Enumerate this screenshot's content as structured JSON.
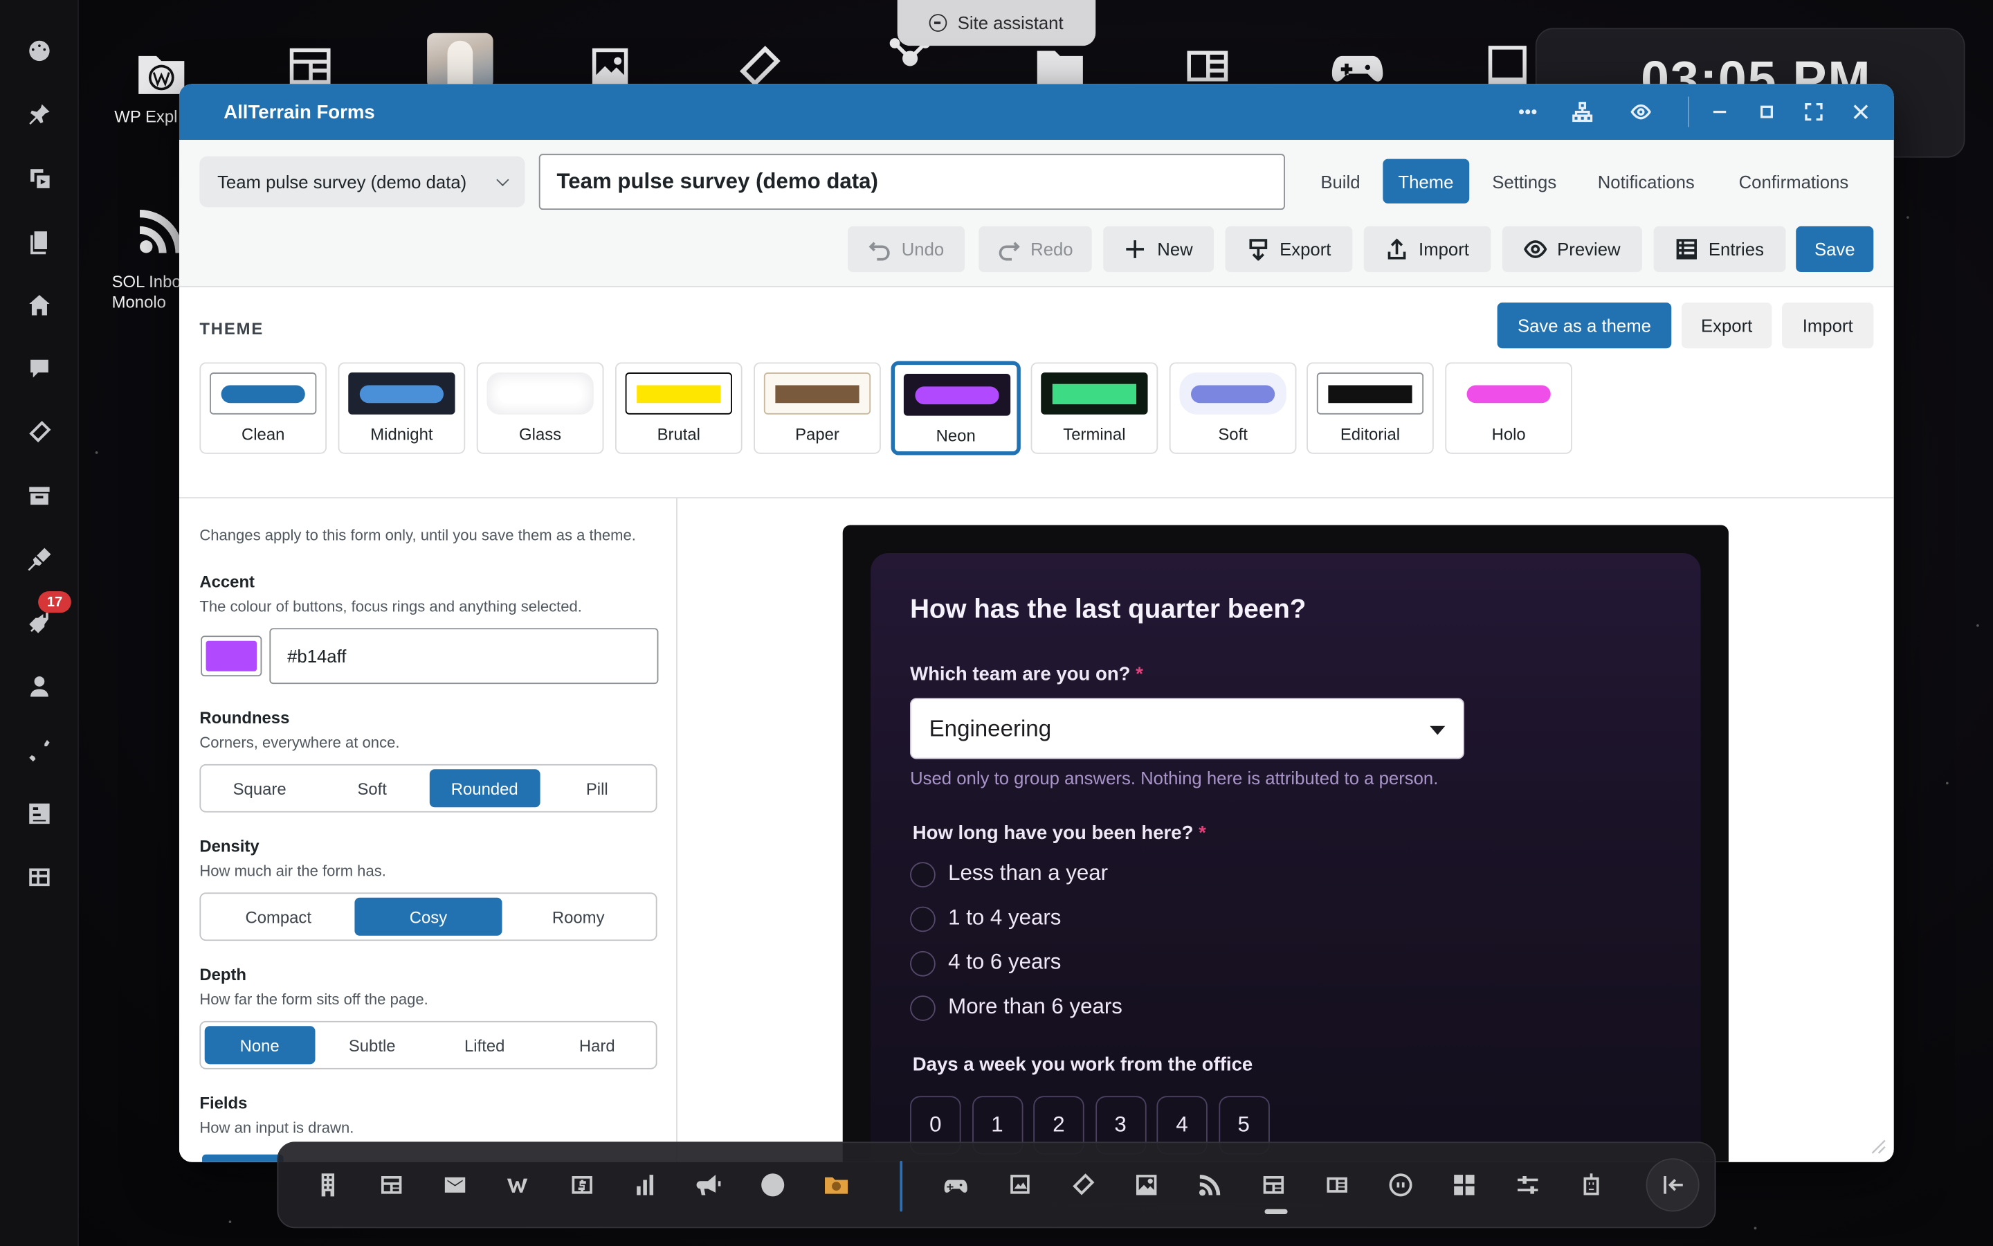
{
  "assistant": {
    "label": "Site assistant"
  },
  "clock": {
    "time": "03:05 PM"
  },
  "adminbar": {
    "badge_count": "17"
  },
  "desktop": {
    "icons": [
      {
        "label": "WP Expl",
        "icon": "wordpress-folder-icon"
      },
      {
        "label": "SOL Inbo\nMonolo",
        "icon": "rss-icon"
      }
    ]
  },
  "window": {
    "title": "AllTerrain Forms",
    "form_select": "Team pulse survey (demo data)",
    "form_title_value": "Team pulse survey (demo data)",
    "tabs": [
      {
        "label": "Build"
      },
      {
        "label": "Theme",
        "active": true
      },
      {
        "label": "Settings"
      },
      {
        "label": "Notifications"
      },
      {
        "label": "Confirmations"
      }
    ],
    "actions": {
      "undo": "Undo",
      "redo": "Redo",
      "new": "New",
      "export": "Export",
      "import": "Import",
      "preview": "Preview",
      "entries": "Entries",
      "save": "Save"
    }
  },
  "theme": {
    "heading": "THEME",
    "save_as_theme": "Save as a theme",
    "export": "Export",
    "import": "Import",
    "selected": "Neon",
    "swatches": [
      {
        "name": "Clean",
        "bg": "#ffffff",
        "bar": "#2271b1",
        "border": "#8c8f94"
      },
      {
        "name": "Midnight",
        "bg": "#1d2230",
        "bar": "#4a90d9",
        "border": "#1d2230"
      },
      {
        "name": "Glass",
        "bg": "#ffffff",
        "bar": "#ffffff",
        "border": "#f0f0f1"
      },
      {
        "name": "Brutal",
        "bg": "#ffffff",
        "bar": "#ffe600",
        "border": "#000000"
      },
      {
        "name": "Paper",
        "bg": "#fbf8f2",
        "bar": "#7a5a3c",
        "border": "#c9b89c"
      },
      {
        "name": "Neon",
        "bg": "#1a1326",
        "bar": "#b14aff",
        "border": "#1a1326"
      },
      {
        "name": "Terminal",
        "bg": "#0d1a12",
        "bar": "#3ddc84",
        "border": "#0d1a12"
      },
      {
        "name": "Soft",
        "bg": "#eef0fb",
        "bar": "#7b86e0",
        "border": "#eef0fb"
      },
      {
        "name": "Editorial",
        "bg": "#ffffff",
        "bar": "#111111",
        "border": "#8c8f94"
      },
      {
        "name": "Holo",
        "bg": "#ffffff",
        "bar": "#ef4fe8",
        "border": "#ffffff"
      }
    ]
  },
  "settings": {
    "note": "Changes apply to this form only, until you save them as a theme.",
    "accent": {
      "label": "Accent",
      "help": "The colour of buttons, focus rings and anything selected.",
      "value": "#b14aff"
    },
    "roundness": {
      "label": "Roundness",
      "help": "Corners, everywhere at once.",
      "options": [
        "Square",
        "Soft",
        "Rounded",
        "Pill"
      ],
      "selected": "Rounded"
    },
    "density": {
      "label": "Density",
      "help": "How much air the form has.",
      "options": [
        "Compact",
        "Cosy",
        "Roomy"
      ],
      "selected": "Cosy"
    },
    "depth": {
      "label": "Depth",
      "help": "How far the form sits off the page.",
      "options": [
        "None",
        "Subtle",
        "Lifted",
        "Hard"
      ],
      "selected": "None"
    },
    "fields": {
      "label": "Fields",
      "help": "How an input is drawn."
    }
  },
  "preview": {
    "title": "How has the last quarter been?",
    "q1": {
      "label": "Which team are you on?",
      "required": "*",
      "value": "Engineering",
      "help": "Used only to group answers. Nothing here is attributed to a person."
    },
    "q2": {
      "label": "How long have you been here?",
      "required": "*",
      "options": [
        "Less than a year",
        "1 to 4 years",
        "4 to 6 years",
        "More than 6 years"
      ]
    },
    "q3": {
      "label": "Days a week you work from the office",
      "options": [
        "0",
        "1",
        "2",
        "3",
        "4",
        "5"
      ]
    }
  },
  "colors": {
    "accent": "#2271b1",
    "titlebar": "#2271b1",
    "neon_accent": "#b14aff",
    "badge": "#d63638"
  }
}
